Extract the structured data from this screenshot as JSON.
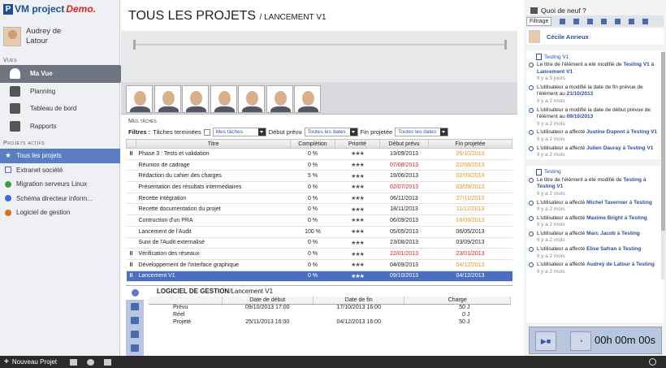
{
  "app": {
    "logo_letter": "P",
    "logo_text": "VM project",
    "demo": "Demo."
  },
  "user": {
    "name": "Audrey de Latour"
  },
  "sections": {
    "vues": "Vues",
    "projets": "Projets actifs"
  },
  "nav": [
    {
      "label": "Ma Vue",
      "icon": "user-icon",
      "active": true
    },
    {
      "label": "Planning",
      "icon": "clock-icon"
    },
    {
      "label": "Tableau de bord",
      "icon": "pie-chart-icon"
    },
    {
      "label": "Rapports",
      "icon": "line-chart-icon"
    }
  ],
  "projects": [
    {
      "label": "Tous les projets",
      "icon": "star-icon",
      "active": true
    },
    {
      "label": "Extranet société",
      "icon": "edit-icon"
    },
    {
      "label": "Migration serveurs Linux",
      "color": "#3aa34a"
    },
    {
      "label": "Schéma directeur inform...",
      "color": "#3a6fd8"
    },
    {
      "label": "Logiciel de gestion",
      "color": "#e06e1a"
    }
  ],
  "header": {
    "title": "TOUS LES PROJETS",
    "subtitle": "/ LANCEMENT V1"
  },
  "mes_taches": "Mes tâches",
  "filters": {
    "label": "Filtres :",
    "terminees": "Tâches terminées",
    "mes_taches_sel": "Mes tâches",
    "debut_label": "Début prévu",
    "debut_sel": "Toutes les dates",
    "fin_label": "Fin projetée",
    "fin_sel": "Toutes les dates"
  },
  "tasks": {
    "columns": [
      "Titre",
      "Complétion",
      "Priorité",
      "Début prévu",
      "Fin projetée"
    ],
    "rows": [
      {
        "grip": "II",
        "title": "Phase 3 : Tests et validation",
        "comp": "0 %",
        "stars": "★★★",
        "start": "13/09/2013",
        "start_c": "",
        "end": "26/10/2013",
        "end_c": "dorange"
      },
      {
        "grip": "",
        "title": "Réunion de cadrage",
        "comp": "0 %",
        "stars": "★★★",
        "start": "07/08/2013",
        "start_c": "dred",
        "end": "22/08/2013",
        "end_c": "dorange"
      },
      {
        "grip": "",
        "title": "Rédaction du cahier des charges",
        "comp": "5 %",
        "stars": "★★★",
        "start": "19/06/2013",
        "start_c": "",
        "end": "02/09/2013",
        "end_c": "dorange"
      },
      {
        "grip": "",
        "title": "Présentation des résultats intermédiaires",
        "comp": "0 %",
        "stars": "★★★",
        "start": "02/07/2013",
        "start_c": "dred",
        "end": "03/09/2013",
        "end_c": "dorange"
      },
      {
        "grip": "",
        "title": "Recette intégration",
        "comp": "0 %",
        "stars": "★★★",
        "start": "06/11/2013",
        "start_c": "",
        "end": "27/11/2013",
        "end_c": "dorange"
      },
      {
        "grip": "",
        "title": "Recette documentation du projet",
        "comp": "0 %",
        "stars": "★★★",
        "start": "18/11/2013",
        "start_c": "",
        "end": "11/12/2013",
        "end_c": "dorange"
      },
      {
        "grip": "",
        "title": "Contruction d'un PRA",
        "comp": "0 %",
        "stars": "★★★",
        "start": "06/09/2013",
        "start_c": "",
        "end": "16/09/2013",
        "end_c": "dorange"
      },
      {
        "grip": "",
        "title": "Lancement de l'Audit",
        "comp": "100 %",
        "stars": "★★★",
        "start": "05/05/2013",
        "start_c": "",
        "end": "06/05/2013",
        "end_c": ""
      },
      {
        "grip": "",
        "title": "Suivi de l'Audit externalisé",
        "comp": "0 %",
        "stars": "★★★",
        "start": "23/08/2013",
        "start_c": "",
        "end": "03/09/2013",
        "end_c": ""
      },
      {
        "grip": "II",
        "title": "Vérification des réseaux",
        "comp": "0 %",
        "stars": "★★★",
        "start": "22/01/2013",
        "start_c": "dred",
        "end": "23/01/2013",
        "end_c": "dred"
      },
      {
        "grip": "II",
        "title": "Développement de l'interface graphique",
        "comp": "0 %",
        "stars": "★★★",
        "start": "04/09/2013",
        "start_c": "",
        "end": "04/12/2013",
        "end_c": "dorange"
      },
      {
        "grip": "II",
        "title": "Lancement V1",
        "comp": "0 %",
        "stars": "★★★",
        "start": "09/10/2013",
        "start_c": "",
        "end": "04/12/2013",
        "end_c": "dorange",
        "selected": true
      }
    ]
  },
  "detail": {
    "project": "LOGICIEL DE GESTION",
    "task": "/Lancement V1",
    "columns": [
      "Date de début",
      "Date de fin",
      "Charge"
    ],
    "rows": [
      {
        "label": "Prévu",
        "start": "09/10/2013 17:00",
        "end": "17/10/2013 16:00",
        "charge": "50 J"
      },
      {
        "label": "Réel",
        "start": "",
        "end": "",
        "charge": "0 J"
      },
      {
        "label": "Projeté",
        "start": "25/11/2013 16:00",
        "end": "04/12/2013 16:00",
        "charge": "50 J"
      }
    ]
  },
  "right": {
    "title": "Quoi de neuf ?",
    "filtrage": "Filtrage",
    "person": "Cécile Anrieux"
  },
  "feed": [
    {
      "section": "Testing V1",
      "entries": [
        {
          "pre": "Le titre de l'élément a été modifié de ",
          "b1": "Testing V1",
          "mid": " à ",
          "b2": "Lancement V1",
          "ago": "Il y a 3 jours"
        },
        {
          "pre": "L'utilisateur a modifié la date de fin prévue de l'élément au ",
          "b1": "21/10/2013",
          "mid": "",
          "b2": "",
          "ago": "Il y a 2 mois"
        },
        {
          "pre": "L'utilisateur a modifié la date de début prévue de l'élément au ",
          "b1": "09/10/2013",
          "mid": "",
          "b2": "",
          "ago": "Il y a 2 mois"
        },
        {
          "pre": "L'utilisateur a affecté ",
          "b1": "Justine Dupont",
          "mid": " à ",
          "b2": "Testing V1",
          "ago": "Il y a 2 mois"
        },
        {
          "pre": "L'utilisateur a affecté ",
          "b1": "Julien Dauray",
          "mid": " à ",
          "b2": "Testing V1",
          "ago": "Il y a 2 mois"
        }
      ]
    },
    {
      "section": "Testing",
      "entries": [
        {
          "pre": "Le titre de l'élément a été modifié de ",
          "b1": "Testing",
          "mid": " à ",
          "b2": "Testing V1",
          "ago": "Il y a 2 mois"
        },
        {
          "pre": "L'utilisateur a affecté ",
          "b1": "Michel Tavernier",
          "mid": " à ",
          "b2": "Testing",
          "ago": "Il y a 2 mois"
        },
        {
          "pre": "L'utilisateur a affecté ",
          "b1": "Maxime Bright",
          "mid": " à ",
          "b2": "Testing",
          "ago": "Il y a 2 mois"
        },
        {
          "pre": "L'utilisateur a affecté ",
          "b1": "Marc Jacob",
          "mid": " à ",
          "b2": "Testing",
          "ago": "Il y a 2 mois"
        },
        {
          "pre": "L'utilisateur a affecté ",
          "b1": "Elise Safran",
          "mid": " à ",
          "b2": "Testing",
          "ago": "Il y a 2 mois"
        },
        {
          "pre": "L'utilisateur a affecté ",
          "b1": "Audrey de Latour",
          "mid": " à ",
          "b2": "Testing",
          "ago": "Il y a 2 mois"
        }
      ]
    }
  ],
  "timer": {
    "time": "00h 00m 00s"
  },
  "bottom": {
    "new_project": "Nouveau Projet"
  }
}
